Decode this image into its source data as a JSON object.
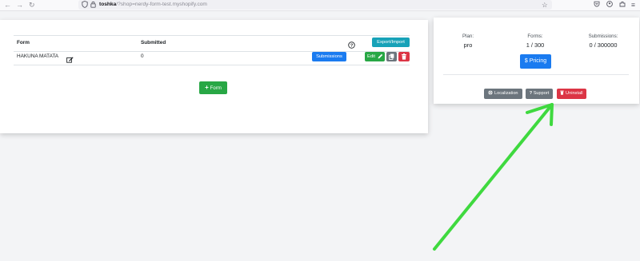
{
  "browser": {
    "nav_back": "←",
    "nav_forward": "→",
    "nav_reload": "↻",
    "url_host": "toshka",
    "url_path": "/?shop=nerdy-form-test.myshopify.com"
  },
  "forms_table": {
    "headers": {
      "form": "Form",
      "submitted": "Submitted"
    },
    "export_import_label": "Export/Import",
    "rows": [
      {
        "form": "HAKUNA MATATA",
        "submitted": "0",
        "submissions_label": "Submissions",
        "edit_label": "Edit"
      }
    ],
    "add_form_label": "Form"
  },
  "plan_card": {
    "plan_label": "Plan:",
    "plan_value": "pro",
    "forms_label": "Forms:",
    "forms_value": "1 / 300",
    "submissions_label": "Submissions:",
    "submissions_value": "0 / 300000",
    "pricing_label": "Pricing",
    "localization_label": "Localization",
    "support_label": "Support",
    "uninstall_label": "Uninstall"
  },
  "colors": {
    "info": "#17a2b8",
    "primary": "#1a7bf0",
    "success": "#28a745",
    "secondary": "#6c757d",
    "danger": "#dc3545",
    "annotation_arrow": "#3fd93f"
  }
}
